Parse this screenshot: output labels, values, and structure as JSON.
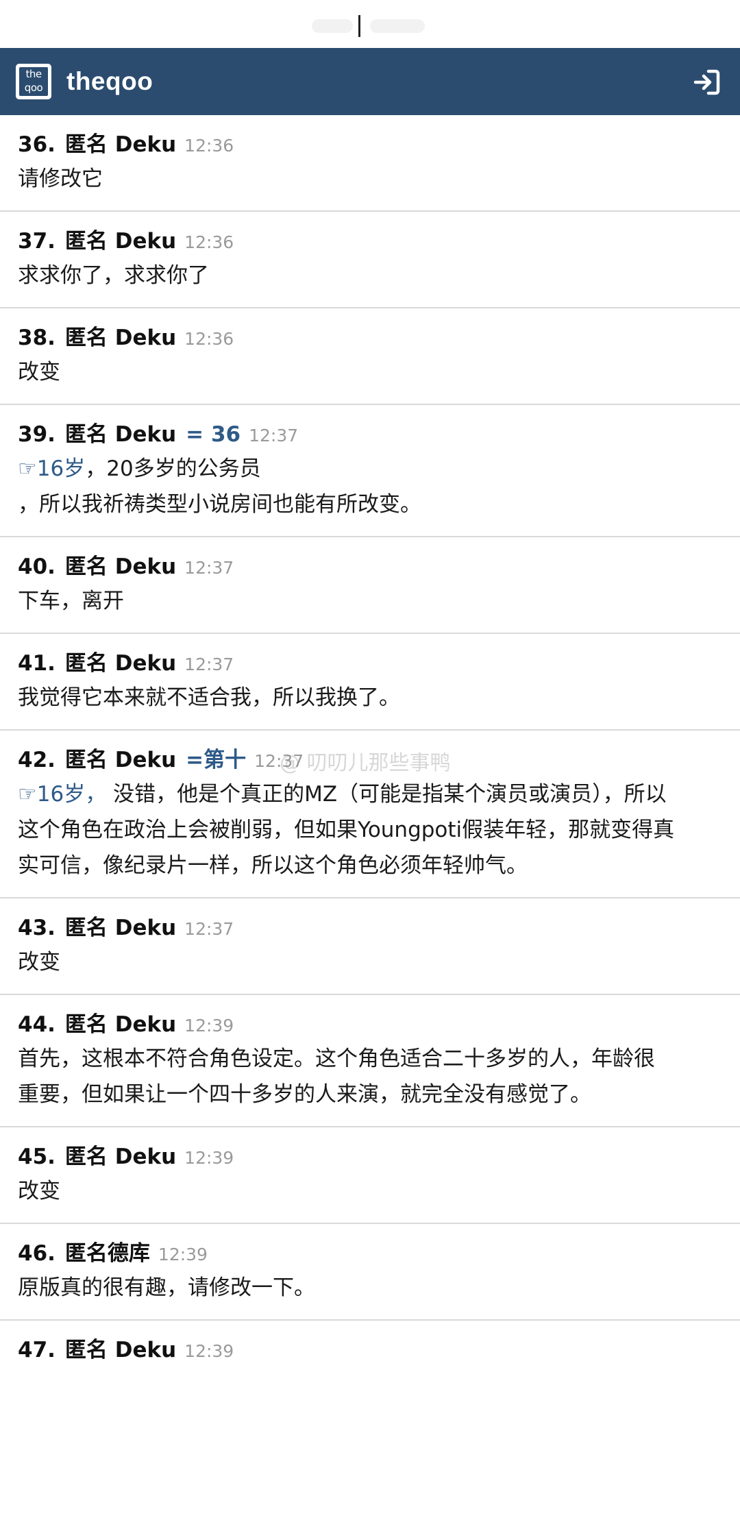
{
  "app": {
    "logo_text": "the qoo",
    "title": "theqoo"
  },
  "comments": [
    {
      "num": "36.",
      "author": "匿名 Deku",
      "reply": "",
      "time": "12:36",
      "lines": [
        "请修改它"
      ]
    },
    {
      "num": "37.",
      "author": "匿名 Deku",
      "reply": "",
      "time": "12:36",
      "lines": [
        "求求你了，求求你了"
      ]
    },
    {
      "num": "38.",
      "author": "匿名 Deku",
      "reply": "",
      "time": "12:36",
      "lines": [
        "改变"
      ]
    },
    {
      "num": "39.",
      "author": "匿名 Deku",
      "reply": "= 36",
      "time": "12:37",
      "quote": "☞16岁",
      "lines": [
        "，20多岁的公务员",
        "，所以我祈祷类型小说房间也能有所改变。"
      ]
    },
    {
      "num": "40.",
      "author": "匿名 Deku",
      "reply": "",
      "time": "12:37",
      "lines": [
        "下车，离开"
      ]
    },
    {
      "num": "41.",
      "author": "匿名 Deku",
      "reply": "",
      "time": "12:37",
      "lines": [
        "我觉得它本来就不适合我，所以我换了。"
      ]
    },
    {
      "num": "42.",
      "author": "匿名 Deku",
      "reply": "=第十",
      "time": "12:37",
      "quote": "☞16岁，",
      "lines": [
        " 没错，他是个真正的MZ（可能是指某个演员或演员），所以",
        "这个角色在政治上会被削弱，但如果Youngpoti假装年轻，那就变得真",
        "实可信，像纪录片一样，所以这个角色必须年轻帅气。"
      ]
    },
    {
      "num": "43.",
      "author": "匿名 Deku",
      "reply": "",
      "time": "12:37",
      "lines": [
        "改变"
      ]
    },
    {
      "num": "44.",
      "author": "匿名 Deku",
      "reply": "",
      "time": "12:39",
      "lines": [
        "首先，这根本不符合角色设定。这个角色适合二十多岁的人，年龄很",
        "重要，但如果让一个四十多岁的人来演，就完全没有感觉了。"
      ]
    },
    {
      "num": "45.",
      "author": "匿名 Deku",
      "reply": "",
      "time": "12:39",
      "lines": [
        "改变"
      ]
    },
    {
      "num": "46.",
      "author": "匿名德库",
      "reply": "",
      "time": "12:39",
      "lines": [
        "原版真的很有趣，请修改一下。"
      ]
    },
    {
      "num": "47.",
      "author": "匿名 Deku",
      "reply": "",
      "time": "12:39",
      "lines": []
    }
  ],
  "watermark": "@ 叨叨儿那些事鸭",
  "colors": {
    "header_bg": "#2b4c6f",
    "reply_link": "#2e5a88",
    "time_text": "#9a9a9a",
    "divider": "#d9d9d9"
  },
  "icons": {
    "login": "sign-in-icon",
    "logo": "theqoo-logo"
  }
}
